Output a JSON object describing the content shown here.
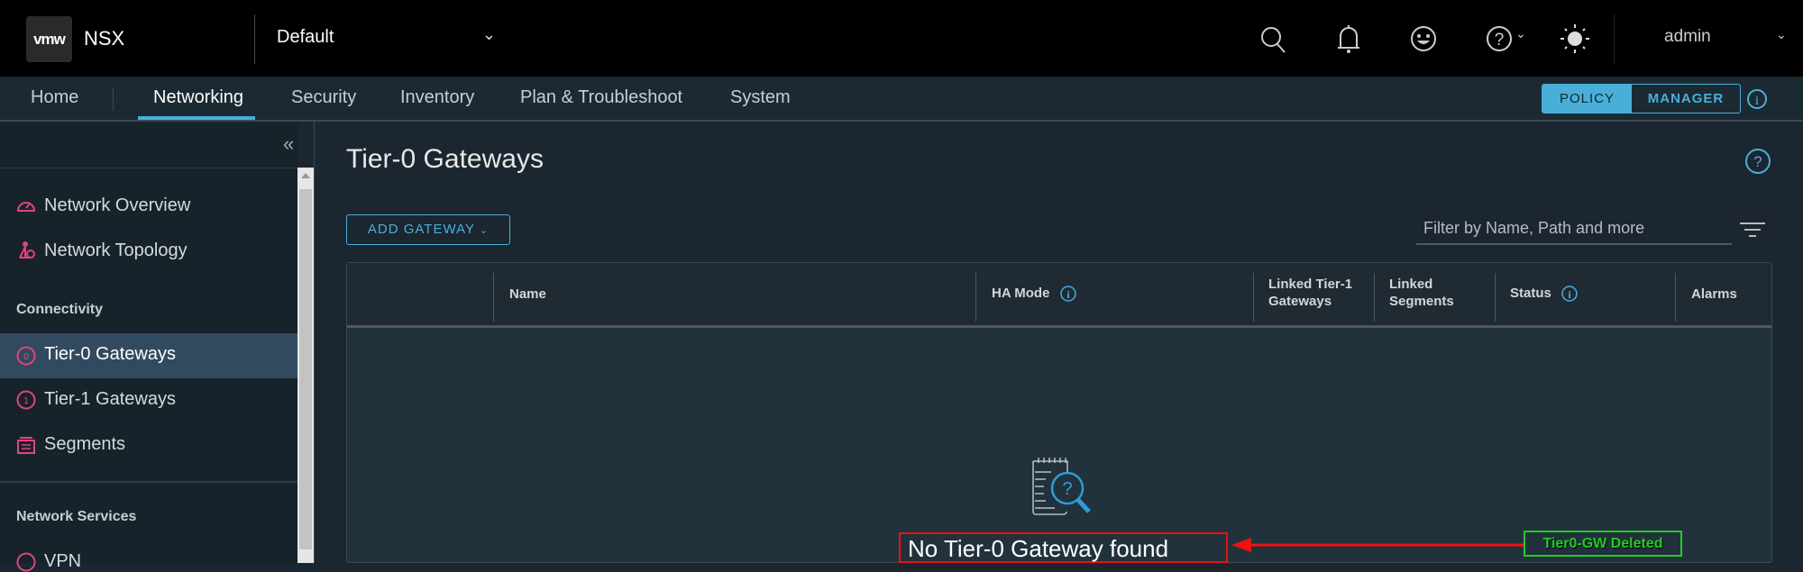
{
  "header": {
    "logo": "vmw",
    "product": "NSX",
    "project": "Default",
    "user": "admin"
  },
  "nav": {
    "items": [
      "Home",
      "Networking",
      "Security",
      "Inventory",
      "Plan & Troubleshoot",
      "System"
    ],
    "active": "Networking",
    "mode_policy": "POLICY",
    "mode_manager": "MANAGER"
  },
  "sidebar": {
    "items_top": [
      "Network Overview",
      "Network Topology"
    ],
    "section_connectivity": "Connectivity",
    "connectivity": [
      "Tier-0 Gateways",
      "Tier-1 Gateways",
      "Segments"
    ],
    "section_services": "Network Services",
    "services": [
      "VPN"
    ]
  },
  "main": {
    "title": "Tier-0 Gateways",
    "add_button": "ADD GATEWAY",
    "filter_placeholder": "Filter by Name, Path and more",
    "columns": [
      "Name",
      "HA Mode",
      "Linked Tier-1 Gateways",
      "Linked Segments",
      "Status",
      "Alarms"
    ],
    "empty_message": "No Tier-0 Gateway found"
  },
  "annotation": {
    "label": "Tier0-GW Deleted",
    "color": "#22cc22",
    "arrow_color": "#ee1111"
  },
  "colors": {
    "accent": "#49afd9",
    "icon_pink": "#e0457b"
  }
}
